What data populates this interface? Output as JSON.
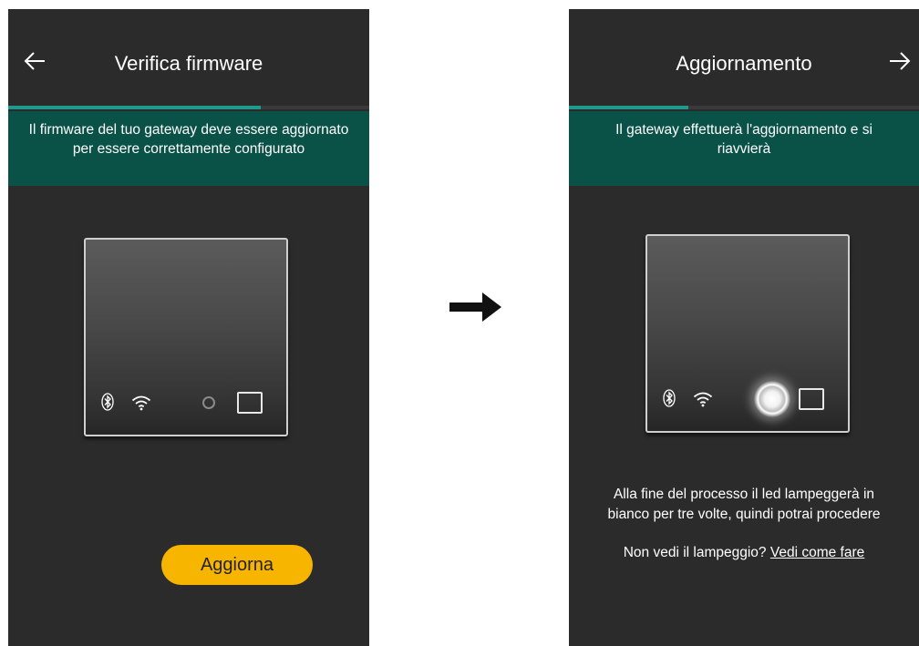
{
  "left": {
    "title": "Verifica firmware",
    "back_icon": "arrow-left-icon",
    "progress": 0.7,
    "banner_text": "Il firmware del tuo gateway deve essere aggiornato per essere correttamente configurato",
    "button_label": "Aggiorna",
    "device_icons": [
      "bluetooth-icon",
      "wifi-icon",
      "led-off-icon",
      "square-button-icon"
    ]
  },
  "right": {
    "title": "Aggiornamento",
    "next_icon": "arrow-right-icon",
    "progress": 0.34,
    "banner_text": "Il gateway effettuerà  l'aggiornamento e si riavvierà",
    "device_icons": [
      "bluetooth-icon",
      "wifi-icon",
      "led-on-icon",
      "square-button-icon"
    ],
    "info_line_1": "Alla fine del processo il led lampeggerà in",
    "info_line_2": "bianco per tre volte, quindi potrai procedere",
    "help_text": "Non vedi il lampeggio? ",
    "help_link": "Vedi come fare"
  },
  "flow_arrow_icon": "arrow-right-icon",
  "colors": {
    "screen_bg": "#2b2b2b",
    "banner_bg": "#0a5248",
    "progress": "#1d9a8c",
    "button_bg": "#f7b500"
  }
}
